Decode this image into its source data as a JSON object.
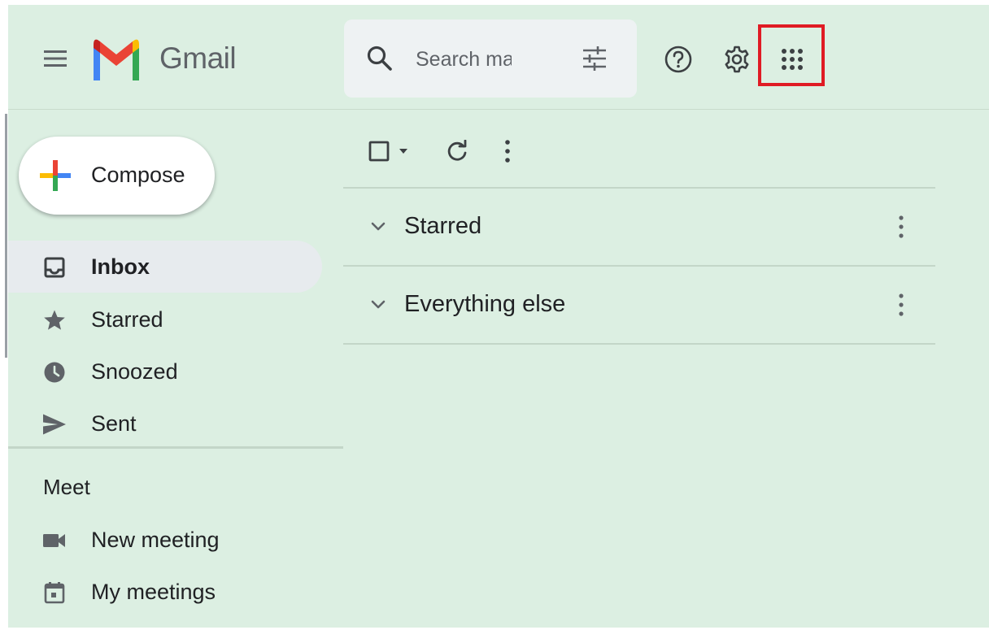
{
  "header": {
    "app_name": "Gmail",
    "search": {
      "placeholder": "Search mail",
      "value": ""
    },
    "icons": {
      "menu": "hamburger-menu-icon",
      "search": "search-icon",
      "search_options": "tune-icon",
      "help": "help-icon",
      "settings": "gear-icon",
      "apps": "apps-grid-icon"
    },
    "highlighted_control": "apps"
  },
  "sidebar": {
    "compose_label": "Compose",
    "items": [
      {
        "label": "Inbox",
        "icon": "inbox-icon",
        "active": true
      },
      {
        "label": "Starred",
        "icon": "star-icon",
        "active": false
      },
      {
        "label": "Snoozed",
        "icon": "clock-icon",
        "active": false
      },
      {
        "label": "Sent",
        "icon": "send-icon",
        "active": false
      }
    ],
    "meet": {
      "heading": "Meet",
      "items": [
        {
          "label": "New meeting",
          "icon": "video-camera-icon"
        },
        {
          "label": "My meetings",
          "icon": "calendar-icon"
        }
      ]
    }
  },
  "main": {
    "toolbar": {
      "icons": [
        "checkbox-icon",
        "dropdown-arrow-icon",
        "refresh-icon",
        "more-vert-icon"
      ]
    },
    "sections": [
      {
        "label": "Starred",
        "expanded": true
      },
      {
        "label": "Everything else",
        "expanded": true
      }
    ]
  },
  "colors": {
    "background": "#dcefe2",
    "highlight_box": "#e01b24",
    "icon_gray": "#5f6368",
    "active_item": "#e7ebee"
  }
}
